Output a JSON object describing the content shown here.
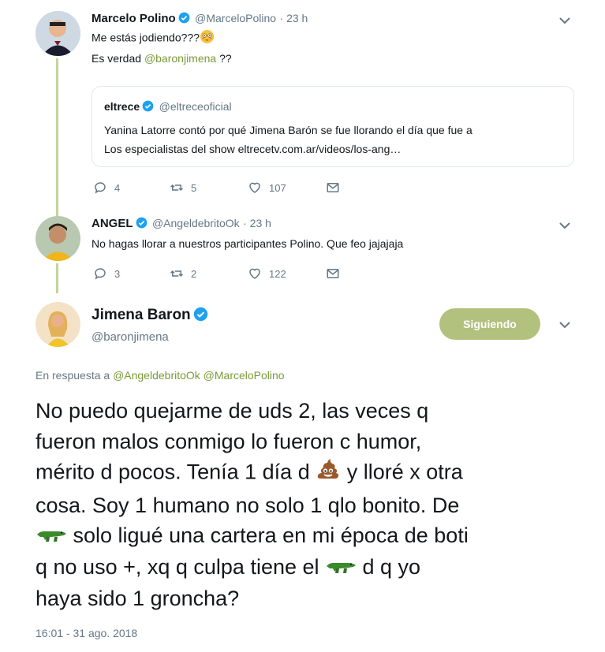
{
  "tweet1": {
    "name": "Marcelo Polino",
    "handle": "@MarceloPolino",
    "time": "· 23 h",
    "line1": "Me estás jodiendo???",
    "line2_pre": "Es verdad ",
    "line2_mention": "@baronjimena",
    "line2_post": " ??",
    "quote": {
      "name": "eltrece",
      "handle": "@eltreceoficial",
      "text1": "Yanina Latorre contó por qué Jimena Barón se fue llorando el día que fue a",
      "text2": "Los especialistas del show eltrecetv.com.ar/videos/los-ang…"
    },
    "replies": "4",
    "retweets": "5",
    "likes": "107"
  },
  "tweet2": {
    "name": "ANGEL",
    "handle": "@AngeldebritoOk",
    "time": "· 23 h",
    "text": "No hagas llorar a nuestros participantes Polino. Que feo jajajaja",
    "replies": "3",
    "retweets": "2",
    "likes": "122"
  },
  "main": {
    "name": "Jimena Baron",
    "handle": "@baronjimena",
    "follow_label": "Siguiendo",
    "reply_prefix": "En respuesta a ",
    "reply_to1": "@AngeldebritoOk",
    "reply_to2": "@MarceloPolino",
    "lines": {
      "l1": "No puedo quejarme de uds 2, las veces q",
      "l2": "fueron malos conmigo lo fueron c humor,",
      "l3a": "mérito d pocos. Tenía 1 día d ",
      "l3b": " y lloré x otra",
      "l4": "cosa. Soy 1 humano no solo 1 qlo bonito. De",
      "l5": " solo ligué una cartera en mi época de boti",
      "l6a": "q no uso +, xq q culpa tiene el ",
      "l6b": " d q yo",
      "l7": "haya sido 1 groncha?"
    },
    "timestamp": "16:01 - 31 ago. 2018"
  },
  "colors": {
    "accent": "#7a9b39",
    "verified": "#1da1f2",
    "follow": "#b3c17f",
    "thread": "#c3d49d"
  },
  "icons": [
    "verified-icon",
    "chevron-down-icon",
    "reply-icon",
    "retweet-icon",
    "like-icon",
    "dm-icon",
    "flushed-emoji-icon",
    "poop-emoji-icon",
    "crocodile-emoji-icon"
  ]
}
